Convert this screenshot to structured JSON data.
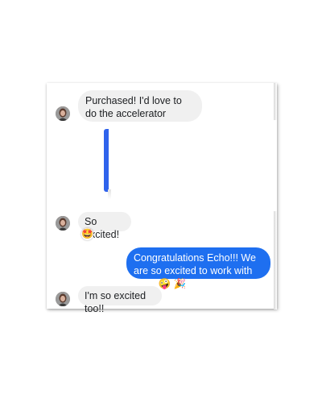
{
  "messages": [
    {
      "direction": "incoming",
      "text": "Purchased! I'd love to do the accelerator"
    },
    {
      "direction": "incoming",
      "text": "So excited!",
      "reaction": "🤩"
    },
    {
      "direction": "outgoing",
      "text": "Congratulations Echo!!! We are so excited to work with you!! 🤪 🎉"
    },
    {
      "direction": "incoming",
      "text": "I'm so excited too!!"
    }
  ],
  "colors": {
    "outgoing_bubble": "#1e6ff0",
    "incoming_bubble": "#f0f0f0",
    "media_strip": "#2f63ec"
  },
  "icons": {
    "avatar": "user-avatar-photo"
  }
}
